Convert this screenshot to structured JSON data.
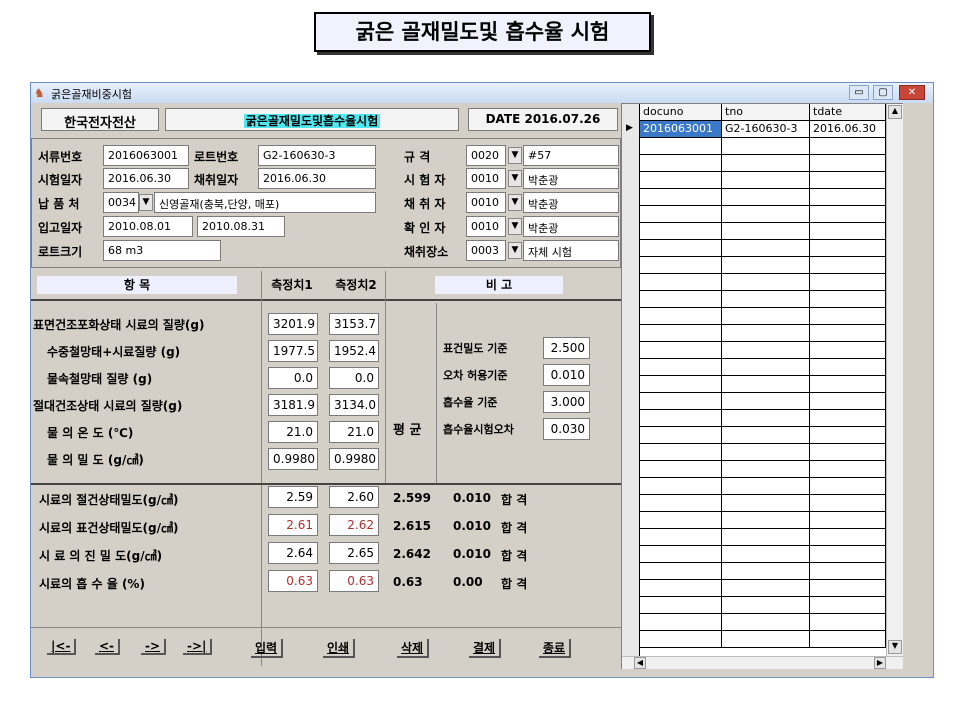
{
  "slide_title": "굵은 골재밀도및 흡수율 시험",
  "window": {
    "title": "굵은골재비중시험",
    "min": "▭",
    "max": "▢",
    "close": "✕"
  },
  "header": {
    "company": "한국전자전산",
    "form_title": "굵은골재밀도및흡수율시험",
    "date": "DATE 2016.07.26"
  },
  "left_fields": {
    "doc_no_label": "서류번호",
    "doc_no": "2016063001",
    "lot_no_label": "로트번호",
    "lot_no": "G2-160630-3",
    "test_date_label": "시험일자",
    "test_date": "2016.06.30",
    "collect_date_label": "채취일자",
    "collect_date": "2016.06.30",
    "supplier_label": "납 품 처",
    "supplier_code": "0034",
    "supplier_name": "신영골재(충북,단양, 매포)",
    "receive_date_label": "입고일자",
    "receive_date_from": "2010.08.01",
    "receive_date_to": "2010.08.31",
    "lot_size_label": "로트크기",
    "lot_size": "68 m3"
  },
  "right_fields": {
    "spec_label": "규 격",
    "spec_code": "0020",
    "spec_value": "#57",
    "tester_label": "시 험 자",
    "tester_code": "0010",
    "tester_name": "박춘광",
    "collector_label": "채 취 자",
    "collector_code": "0010",
    "collector_name": "박춘광",
    "checker_label": "확 인 자",
    "checker_code": "0010",
    "checker_name": "박춘광",
    "place_label": "채취장소",
    "place_code": "0003",
    "place_name": "자체 시험"
  },
  "table_headers": {
    "item": "항 목",
    "m1": "측정치1",
    "m2": "측정치2",
    "remark": "비 고"
  },
  "rows": [
    {
      "label": "표면건조포화상태 시료의 질량(g)",
      "v1": "3201.9",
      "v2": "3153.7"
    },
    {
      "label": "수중철망태+시료질량 (g)",
      "v1": "1977.5",
      "v2": "1952.4"
    },
    {
      "label": "물속철망태 질량 (g)",
      "v1": "0.0",
      "v2": "0.0"
    },
    {
      "label": "절대건조상태 시료의 질량(g)",
      "v1": "3181.9",
      "v2": "3134.0"
    },
    {
      "label": "물 의 온 도 (℃)",
      "v1": "21.0",
      "v2": "21.0"
    },
    {
      "label": "물 의 밀 도 (g/㎤)",
      "v1": "0.9980",
      "v2": "0.9980"
    }
  ],
  "avg_label": "평 균",
  "criteria": [
    {
      "label": "표건밀도 기준",
      "value": "2.500"
    },
    {
      "label": "오차 허용기준",
      "value": "0.010"
    },
    {
      "label": "흡수율 기준",
      "value": "3.000"
    },
    {
      "label": "흡수율시험오차",
      "value": "0.030"
    }
  ],
  "results": [
    {
      "label": "시료의 절건상태밀도(g/㎤)",
      "v1": "2.59",
      "v2": "2.60",
      "avg": "2.599",
      "err": "0.010",
      "verdict": "합 격",
      "red": false
    },
    {
      "label": "시료의 표건상태밀도(g/㎤)",
      "v1": "2.61",
      "v2": "2.62",
      "avg": "2.615",
      "err": "0.010",
      "verdict": "합 격",
      "red": true
    },
    {
      "label": "시 료 의 진 밀 도(g/㎤)",
      "v1": "2.64",
      "v2": "2.65",
      "avg": "2.642",
      "err": "0.010",
      "verdict": "합 격",
      "red": false
    },
    {
      "label": "시료의 흡 수 율 (%)",
      "v1": "0.63",
      "v2": "0.63",
      "avg": "0.63",
      "err": "0.00",
      "verdict": "합 격",
      "red": true
    }
  ],
  "nav_buttons": [
    "|<-",
    "<-",
    "->",
    "->|"
  ],
  "action_buttons": [
    "입력",
    "인쇄",
    "삭제",
    "결제",
    "종료"
  ],
  "grid": {
    "columns": [
      "docuno",
      "tno",
      "tdate"
    ],
    "rows": [
      [
        "2016063001",
        "G2-160630-3",
        "2016.06.30"
      ]
    ]
  }
}
